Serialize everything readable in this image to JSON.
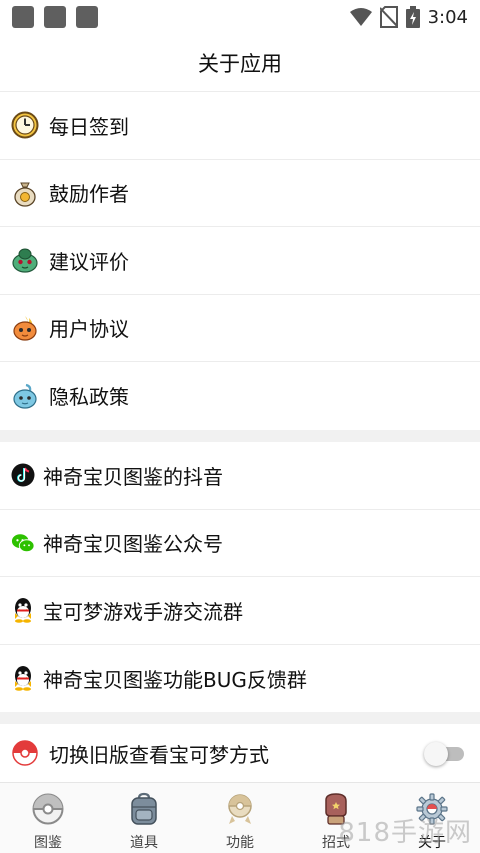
{
  "status_bar": {
    "time": "3:04"
  },
  "header": {
    "title": "关于应用"
  },
  "section1": [
    {
      "label": "每日签到",
      "icon": "clock-icon"
    },
    {
      "label": "鼓励作者",
      "icon": "money-bag-icon"
    },
    {
      "label": "建议评价",
      "icon": "bulbasaur-icon"
    },
    {
      "label": "用户协议",
      "icon": "charmander-icon"
    },
    {
      "label": "隐私政策",
      "icon": "squirtle-icon"
    }
  ],
  "section2": [
    {
      "label": "神奇宝贝图鉴的抖音",
      "icon": "tiktok-icon"
    },
    {
      "label": "神奇宝贝图鉴公众号",
      "icon": "wechat-icon"
    },
    {
      "label": "宝可梦游戏手游交流群",
      "icon": "qq-icon"
    },
    {
      "label": "神奇宝贝图鉴功能BUG反馈群",
      "icon": "qq-icon"
    }
  ],
  "section3": {
    "label": "切换旧版查看宝可梦方式",
    "icon": "pokeball-icon",
    "toggle_on": false
  },
  "bottom_nav": [
    {
      "label": "图鉴",
      "icon": "pokeball-icon"
    },
    {
      "label": "道具",
      "icon": "backpack-icon"
    },
    {
      "label": "功能",
      "icon": "badge-icon"
    },
    {
      "label": "招式",
      "icon": "boxing-glove-icon"
    },
    {
      "label": "关于",
      "icon": "gear-icon",
      "active": true
    }
  ],
  "watermark": "818手游网",
  "colors": {
    "divider": "#ececec",
    "section_gap": "#f1f1f1",
    "toggle_off": "#bdbdbd"
  }
}
